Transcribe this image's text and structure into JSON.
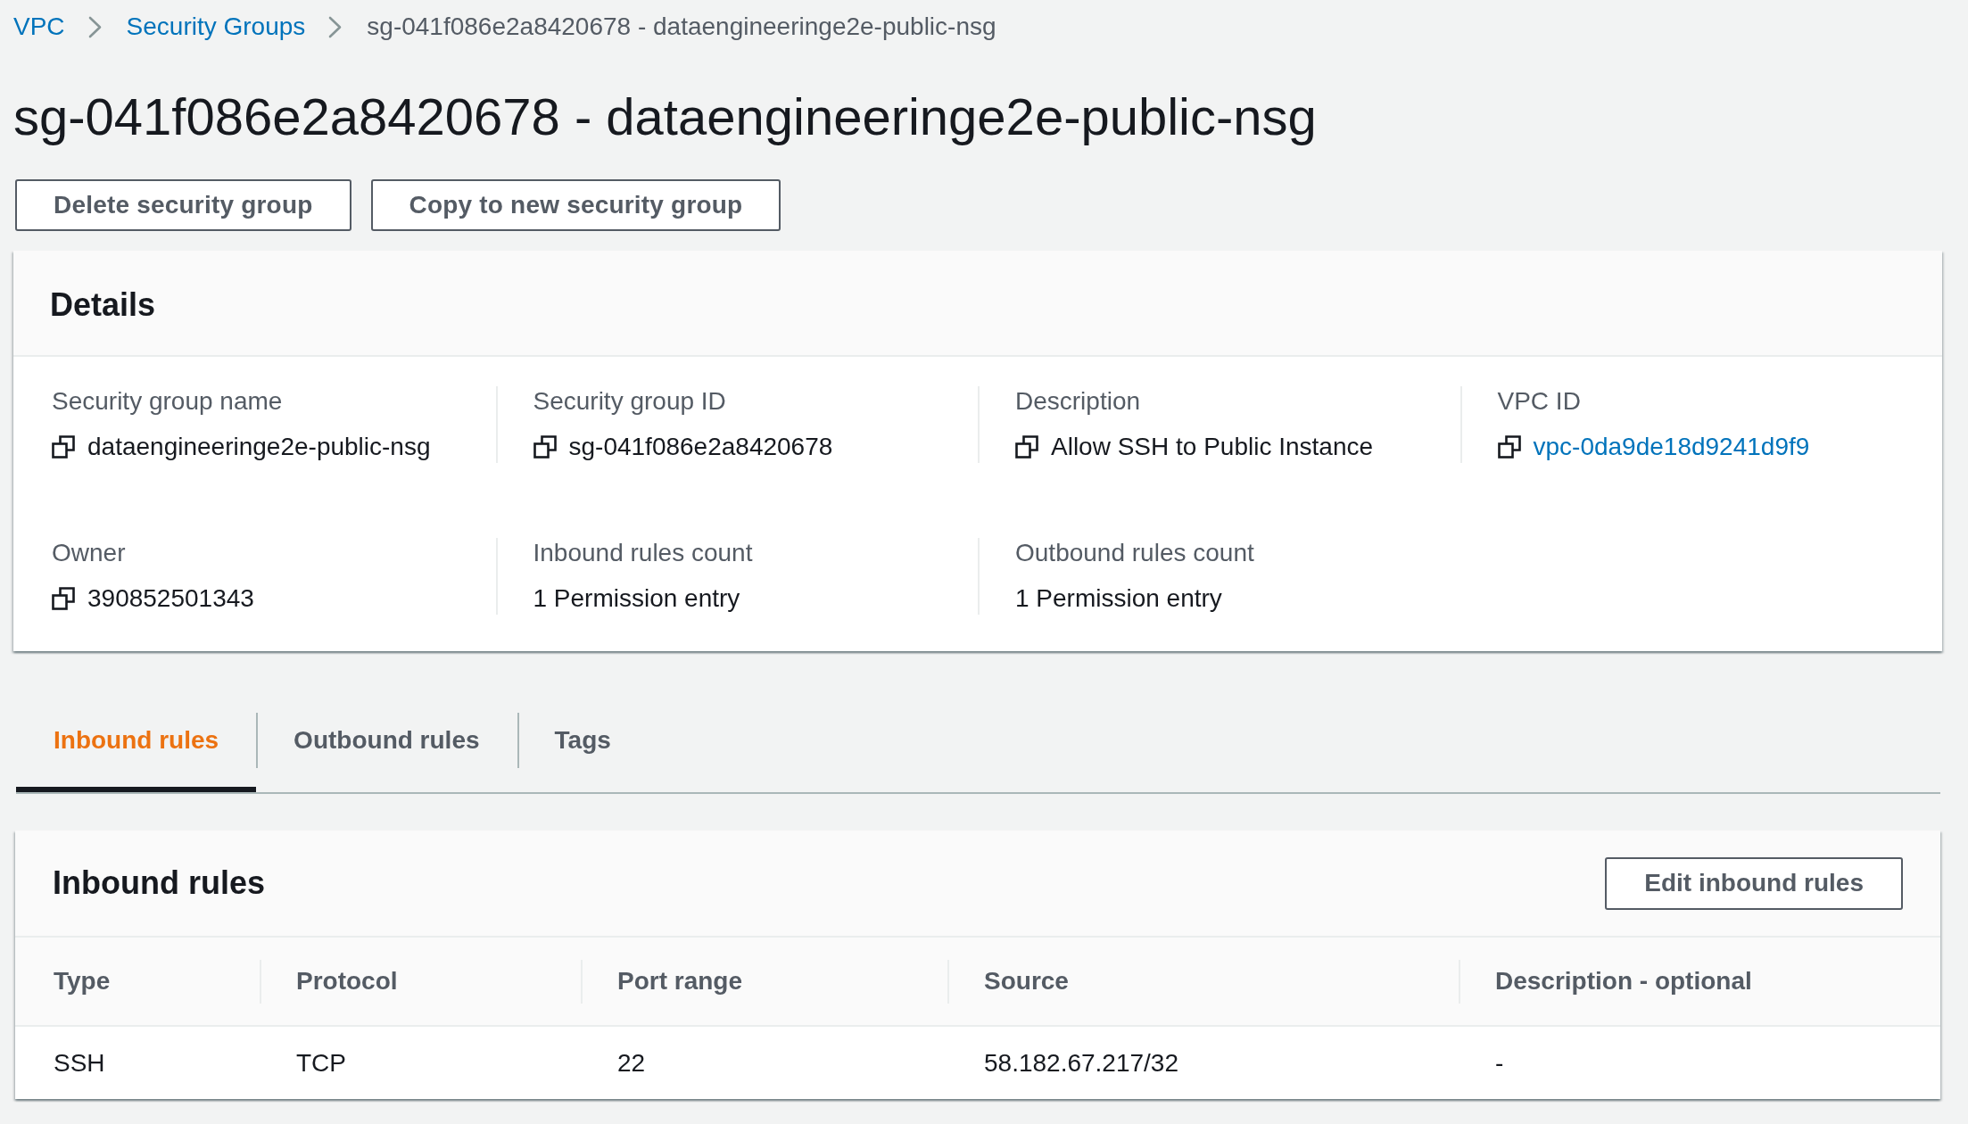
{
  "breadcrumbs": [
    {
      "label": "VPC",
      "current": false
    },
    {
      "label": "Security Groups",
      "current": false
    },
    {
      "label": "sg-041f086e2a8420678 - dataengineeringe2e-public-nsg",
      "current": true
    }
  ],
  "title": "sg-041f086e2a8420678 - dataengineeringe2e-public-nsg",
  "actions": [
    "Delete security group",
    "Copy to new security group"
  ],
  "details": {
    "title": "Details",
    "fields": [
      {
        "label": "Security group name",
        "value": "dataengineeringe2e-public-nsg",
        "copyable": true,
        "link": false
      },
      {
        "label": "Security group ID",
        "value": "sg-041f086e2a8420678",
        "copyable": true,
        "link": false
      },
      {
        "label": "Description",
        "value": "Allow SSH to Public Instance",
        "copyable": true,
        "link": false
      },
      {
        "label": "VPC ID",
        "value": "vpc-0da9de18d9241d9f9",
        "copyable": true,
        "link": true
      },
      {
        "label": "Owner",
        "value": "390852501343",
        "copyable": true,
        "link": false
      },
      {
        "label": "Inbound rules count",
        "value": "1 Permission entry",
        "copyable": false,
        "link": false
      },
      {
        "label": "Outbound rules count",
        "value": "1 Permission entry",
        "copyable": false,
        "link": false
      }
    ]
  },
  "tabs": [
    {
      "label": "Inbound rules",
      "selected": true
    },
    {
      "label": "Outbound rules",
      "selected": false
    },
    {
      "label": "Tags",
      "selected": false
    }
  ],
  "inbound_rules": {
    "title": "Inbound rules",
    "edit_button": "Edit inbound rules",
    "columns": [
      "Type",
      "Protocol",
      "Port range",
      "Source",
      "Description - optional"
    ],
    "rows": [
      [
        "SSH",
        "TCP",
        "22",
        "58.182.67.217/32",
        "-"
      ]
    ]
  }
}
